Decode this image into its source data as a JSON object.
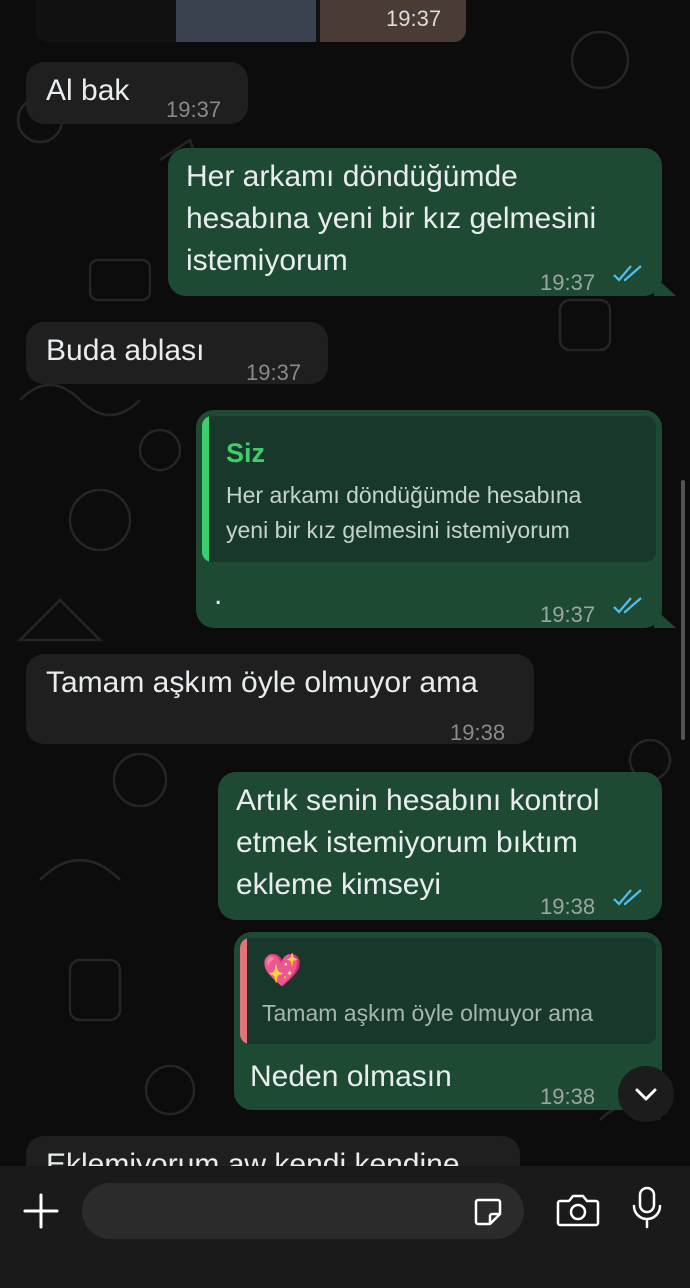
{
  "messages": {
    "m0": {
      "time": "19:37"
    },
    "m1": {
      "text": "Al bak",
      "time": "19:37"
    },
    "m2": {
      "line1": "Her arkamı döndüğümde",
      "line2": "hesabına yeni bir kız gelmesini",
      "line3": "istemiyorum",
      "time": "19:37"
    },
    "m3": {
      "text": "Buda ablası",
      "time": "19:37"
    },
    "m4": {
      "quote_author": "Siz",
      "quote_line1": "Her arkamı döndüğümde hesabına",
      "quote_line2": "yeni bir kız gelmesini istemiyorum",
      "text": ".",
      "time": "19:37"
    },
    "m5": {
      "text": "Tamam aşkım öyle olmuyor ama",
      "time": "19:38"
    },
    "m6": {
      "line1": "Artık senin hesabını kontrol",
      "line2": "etmek istemiyorum bıktım",
      "line3": "ekleme kimseyi",
      "time": "19:38"
    },
    "m7": {
      "quote_emoji": "💖",
      "quote_text": "Tamam aşkım öyle olmuyor ama",
      "text": "Neden olmasın",
      "time": "19:38"
    },
    "m8": {
      "text": "Eklemiyorum aw kendi kendine"
    }
  },
  "colors": {
    "incoming_bubble": "#1f1f1f",
    "outgoing_bubble": "#1e4a33",
    "quote_you_accent": "#3ccf6b",
    "quote_other_accent": "#e5737a",
    "read_ticks": "#53bdeb"
  },
  "icons": {
    "attach": "plus-icon",
    "sticker": "sticker-icon",
    "camera": "camera-icon",
    "mic": "microphone-icon",
    "scroll": "chevron-down-icon"
  }
}
